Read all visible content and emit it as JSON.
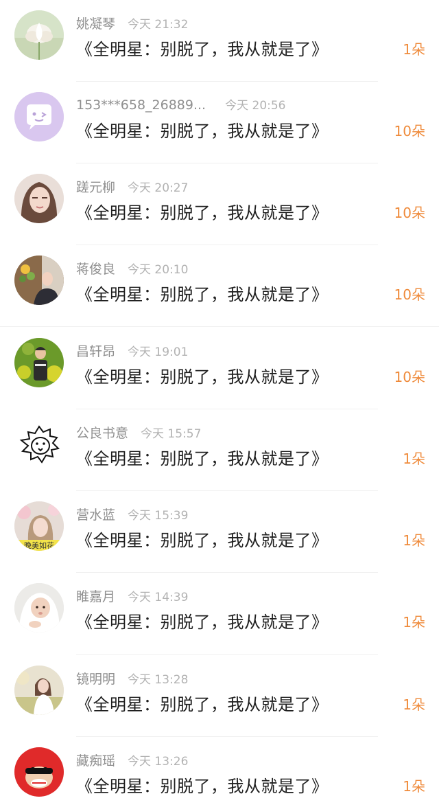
{
  "colors": {
    "name": "#8f8f8f",
    "time": "#b2b2b2",
    "title": "#1f1f1f",
    "count": "#ef8a3a"
  },
  "gifts": [
    {
      "name": "姚凝琴",
      "time": "今天 21:32",
      "title": "《全明星：别脱了，我从就是了》",
      "count": "1朵",
      "avatar": "lotus-flower"
    },
    {
      "name": "153***658_26889...",
      "time": "今天 20:56",
      "title": "《全明星：别脱了，我从就是了》",
      "count": "10朵",
      "avatar": "chat-bubble-face"
    },
    {
      "name": "蹉元柳",
      "time": "今天 20:27",
      "title": "《全明星：别脱了，我从就是了》",
      "count": "10朵",
      "avatar": "woman-portrait"
    },
    {
      "name": "蒋俊良",
      "time": "今天 20:10",
      "title": "《全明星：别脱了，我从就是了》",
      "count": "10朵",
      "avatar": "woman-with-flowers"
    },
    {
      "name": "昌轩昂",
      "time": "今天 19:01",
      "title": "《全明星：别脱了，我从就是了》",
      "count": "10朵",
      "avatar": "child-in-field"
    },
    {
      "name": "公良书意",
      "time": "今天 15:57",
      "title": "《全明星：别脱了，我从就是了》",
      "count": "1朵",
      "avatar": "lion-sketch"
    },
    {
      "name": "营水蓝",
      "time": "今天 15:39",
      "title": "《全明星：别脱了，我从就是了》",
      "count": "1朵",
      "avatar": "girl-with-text-banner",
      "avatar_text": "晚美如花"
    },
    {
      "name": "睢嘉月",
      "time": "今天 14:39",
      "title": "《全明星：别脱了，我从就是了》",
      "count": "1朵",
      "avatar": "baby-in-towel"
    },
    {
      "name": "镜明明",
      "time": "今天 13:28",
      "title": "《全明星：别脱了，我从就是了》",
      "count": "1朵",
      "avatar": "woman-outdoors"
    },
    {
      "name": "藏痴瑶",
      "time": "今天 13:26",
      "title": "《全明星：别脱了，我从就是了》",
      "count": "1朵",
      "avatar": "monkey-cartoon"
    }
  ]
}
